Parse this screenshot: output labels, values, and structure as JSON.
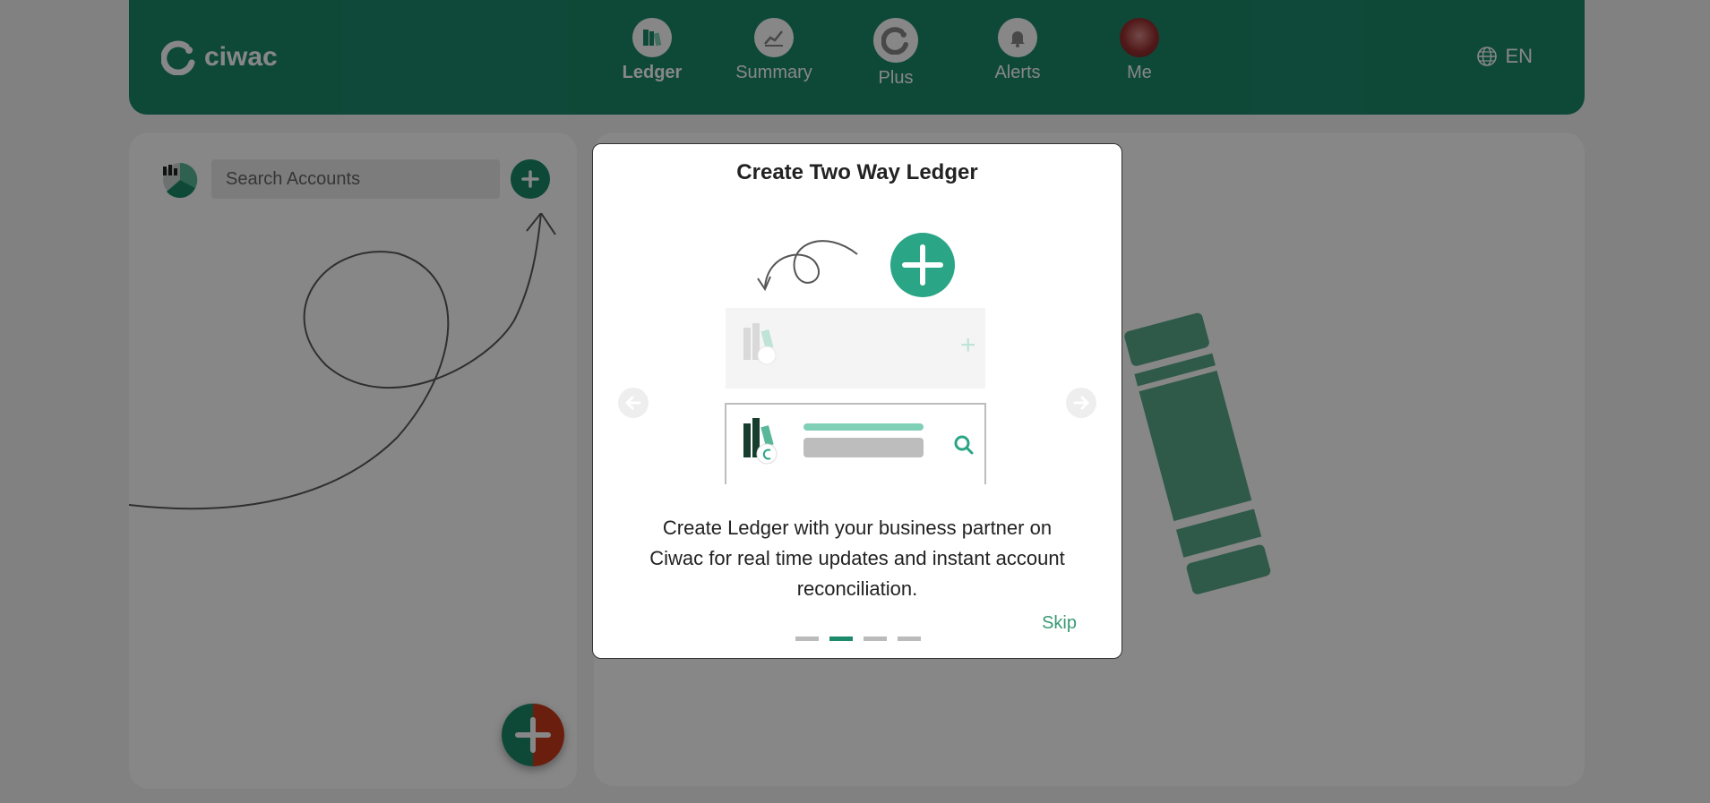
{
  "header": {
    "logo_text": "ciwac",
    "nav": [
      {
        "label": "Ledger",
        "icon": "ledger-icon"
      },
      {
        "label": "Summary",
        "icon": "chart-icon"
      },
      {
        "label": "Plus",
        "icon": "plus-logo-icon"
      },
      {
        "label": "Alerts",
        "icon": "bell-icon"
      },
      {
        "label": "Me",
        "icon": "avatar"
      }
    ],
    "lang": "EN"
  },
  "left": {
    "search_placeholder": "Search Accounts"
  },
  "modal": {
    "title": "Create Two Way Ledger",
    "description": "Create Ledger with your business partner on Ciwac for real time updates and instant account reconciliation.",
    "skip": "Skip",
    "page_index": 2,
    "page_count": 4
  },
  "colors": {
    "brand": "#1c8a6b",
    "accent_light": "#7fd0b6",
    "fab_red": "#c93a1a"
  }
}
